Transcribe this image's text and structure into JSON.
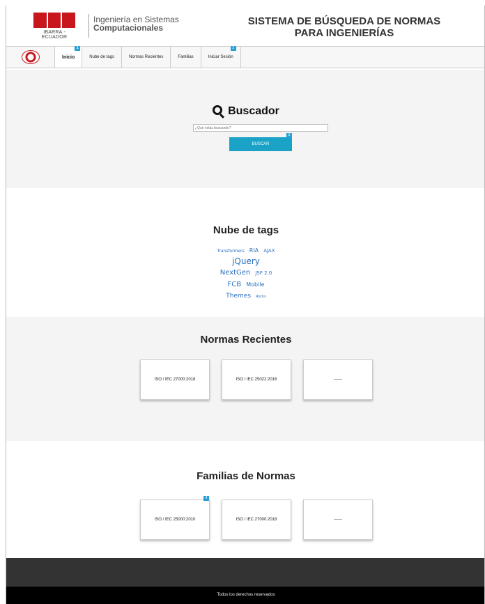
{
  "header": {
    "logo_subtext": "IBARRA - ECUADOR",
    "brand_line1": "Ingeniería en Sistemas",
    "brand_line2": "Computacionales",
    "title_line1": "SISTEMA DE BÚSQUEDA DE NORMAS",
    "title_line2": "PARA INGENIERÍAS"
  },
  "nav": {
    "items": [
      {
        "label": "Inicio",
        "badge": "1"
      },
      {
        "label": "Nube de tags"
      },
      {
        "label": "Normas Recientes"
      },
      {
        "label": "Familias"
      },
      {
        "label": "Iniciar Sesión",
        "badge": "2"
      }
    ]
  },
  "search": {
    "title": "Buscador",
    "placeholder": "¿Qué estás buscando?",
    "button_label": "BUSCAR",
    "button_badge": "3"
  },
  "tags": {
    "heading": "Nube de tags",
    "items": [
      "Transformers",
      "RIA",
      "AJAX",
      "jQuery",
      "NextGen",
      "JSF 2.0",
      "FCB",
      "Mobile",
      "Themes",
      "Rocks"
    ]
  },
  "recent": {
    "heading": "Normas Recientes",
    "cards": [
      "ISO / IEC 27000:2018",
      "ISO / IEC 25022:2016",
      "------"
    ]
  },
  "families": {
    "heading": "Familias de Normas",
    "badge": "4",
    "cards": [
      "ISO / IEC 25000:2010",
      "ISO / IEC 27000:2018",
      "------"
    ]
  },
  "footer": {
    "text": "Todos los derechos reservados"
  },
  "colors": {
    "brand_red": "#c8161d",
    "accent_blue": "#1aa3c6",
    "badge_blue": "#2a9fd6",
    "tag_blue": "#2a6ebb"
  }
}
